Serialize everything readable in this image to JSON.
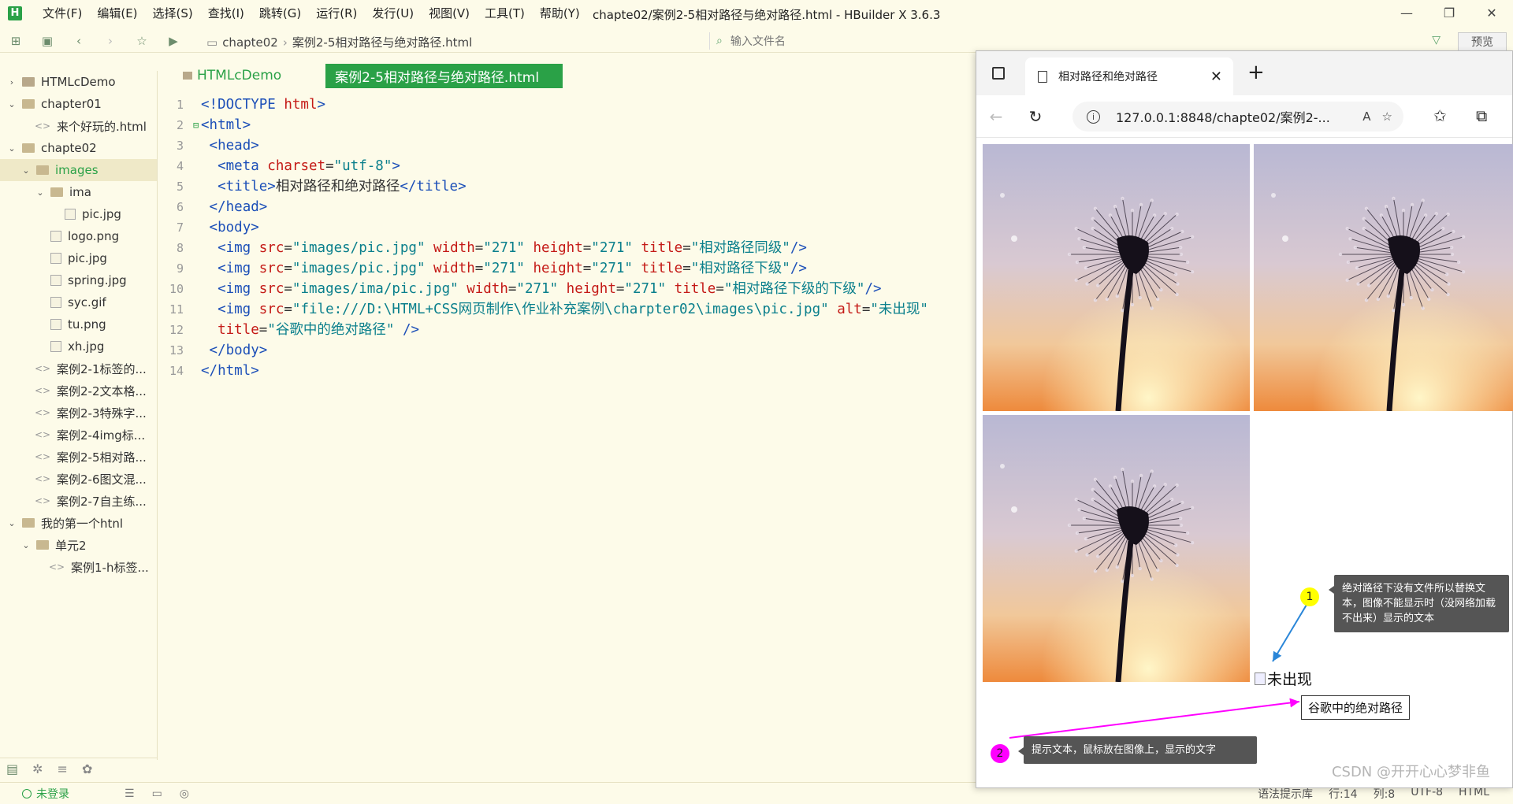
{
  "app": {
    "logo": "H",
    "window_title": "chapte02/案例2-5相对路径与绝对路径.html - HBuilder X 3.6.3",
    "menu": [
      "文件(F)",
      "编辑(E)",
      "选择(S)",
      "查找(I)",
      "跳转(G)",
      "运行(R)",
      "发行(U)",
      "视图(V)",
      "工具(T)",
      "帮助(Y)"
    ]
  },
  "toolbar": {
    "breadcrumb": [
      "chapte02",
      "案例2-5相对路径与绝对路径.html"
    ],
    "file_search_placeholder": "输入文件名",
    "preview_label": "预览"
  },
  "sidebar": {
    "items": [
      {
        "label": "HTMLcDemo",
        "level": 0,
        "kind": "folder",
        "caret": "›"
      },
      {
        "label": "chapter01",
        "level": 0,
        "kind": "folder",
        "caret": "⌄"
      },
      {
        "label": "来个好玩的.html",
        "level": 1,
        "kind": "file",
        "caret": ""
      },
      {
        "label": "chapte02",
        "level": 0,
        "kind": "folder",
        "caret": "⌄"
      },
      {
        "label": "images",
        "level": 1,
        "kind": "folder",
        "caret": "⌄",
        "selected": true
      },
      {
        "label": "ima",
        "level": 2,
        "kind": "folder",
        "caret": "⌄"
      },
      {
        "label": "pic.jpg",
        "level": 3,
        "kind": "image",
        "caret": ""
      },
      {
        "label": "logo.png",
        "level": 2,
        "kind": "image",
        "caret": ""
      },
      {
        "label": "pic.jpg",
        "level": 2,
        "kind": "image",
        "caret": ""
      },
      {
        "label": "spring.jpg",
        "level": 2,
        "kind": "image",
        "caret": ""
      },
      {
        "label": "syc.gif",
        "level": 2,
        "kind": "image",
        "caret": ""
      },
      {
        "label": "tu.png",
        "level": 2,
        "kind": "image",
        "caret": ""
      },
      {
        "label": "xh.jpg",
        "level": 2,
        "kind": "image",
        "caret": ""
      },
      {
        "label": "案例2-1标签的...",
        "level": 1,
        "kind": "file",
        "caret": ""
      },
      {
        "label": "案例2-2文本格...",
        "level": 1,
        "kind": "file",
        "caret": ""
      },
      {
        "label": "案例2-3特殊字...",
        "level": 1,
        "kind": "file",
        "caret": ""
      },
      {
        "label": "案例2-4img标...",
        "level": 1,
        "kind": "file",
        "caret": ""
      },
      {
        "label": "案例2-5相对路...",
        "level": 1,
        "kind": "file",
        "caret": ""
      },
      {
        "label": "案例2-6图文混...",
        "level": 1,
        "kind": "file",
        "caret": ""
      },
      {
        "label": "案例2-7自主练...",
        "level": 1,
        "kind": "file",
        "caret": ""
      },
      {
        "label": "我的第一个htnl",
        "level": 0,
        "kind": "folder",
        "caret": "⌄"
      },
      {
        "label": "单元2",
        "level": 1,
        "kind": "folder",
        "caret": "⌄"
      },
      {
        "label": "案例1-h标签...",
        "level": 2,
        "kind": "file",
        "caret": ""
      }
    ]
  },
  "editor": {
    "folder_tab": "HTMLcDemo",
    "active_tab": "案例2-5相对路径与绝对路径.html",
    "lines": [
      [
        [
          "doc",
          "<!DOCTYPE "
        ],
        [
          "attr",
          "html"
        ],
        [
          "doc",
          ">"
        ]
      ],
      [
        [
          "tag",
          "<html>"
        ]
      ],
      [
        [
          "txt",
          " "
        ],
        [
          "tag",
          "<head>"
        ]
      ],
      [
        [
          "txt",
          "  "
        ],
        [
          "tag",
          "<meta "
        ],
        [
          "attr",
          "charset"
        ],
        [
          "txt",
          "="
        ],
        [
          "str",
          "\"utf-8\""
        ],
        [
          "tag",
          ">"
        ]
      ],
      [
        [
          "txt",
          "  "
        ],
        [
          "tag",
          "<title>"
        ],
        [
          "txt",
          "相对路径和绝对路径"
        ],
        [
          "tag",
          "</title>"
        ]
      ],
      [
        [
          "txt",
          " "
        ],
        [
          "tag",
          "</head>"
        ]
      ],
      [
        [
          "txt",
          " "
        ],
        [
          "tag",
          "<body>"
        ]
      ],
      [
        [
          "txt",
          "  "
        ],
        [
          "tag",
          "<img "
        ],
        [
          "attr",
          "src"
        ],
        [
          "txt",
          "="
        ],
        [
          "str",
          "\"images/pic.jpg\""
        ],
        [
          "txt",
          " "
        ],
        [
          "attr",
          "width"
        ],
        [
          "txt",
          "="
        ],
        [
          "str",
          "\"271\""
        ],
        [
          "txt",
          " "
        ],
        [
          "attr",
          "height"
        ],
        [
          "txt",
          "="
        ],
        [
          "str",
          "\"271\""
        ],
        [
          "txt",
          " "
        ],
        [
          "attr",
          "title"
        ],
        [
          "txt",
          "="
        ],
        [
          "str",
          "\"相对路径同级\""
        ],
        [
          "tag",
          "/>"
        ]
      ],
      [
        [
          "txt",
          "  "
        ],
        [
          "tag",
          "<img "
        ],
        [
          "attr",
          "src"
        ],
        [
          "txt",
          "="
        ],
        [
          "str",
          "\"images/pic.jpg\""
        ],
        [
          "txt",
          " "
        ],
        [
          "attr",
          "width"
        ],
        [
          "txt",
          "="
        ],
        [
          "str",
          "\"271\""
        ],
        [
          "txt",
          " "
        ],
        [
          "attr",
          "height"
        ],
        [
          "txt",
          "="
        ],
        [
          "str",
          "\"271\""
        ],
        [
          "txt",
          " "
        ],
        [
          "attr",
          "title"
        ],
        [
          "txt",
          "="
        ],
        [
          "str",
          "\"相对路径下级\""
        ],
        [
          "tag",
          "/>"
        ]
      ],
      [
        [
          "txt",
          "  "
        ],
        [
          "tag",
          "<img "
        ],
        [
          "attr",
          "src"
        ],
        [
          "txt",
          "="
        ],
        [
          "str",
          "\"images/ima/pic.jpg\""
        ],
        [
          "txt",
          " "
        ],
        [
          "attr",
          "width"
        ],
        [
          "txt",
          "="
        ],
        [
          "str",
          "\"271\""
        ],
        [
          "txt",
          " "
        ],
        [
          "attr",
          "height"
        ],
        [
          "txt",
          "="
        ],
        [
          "str",
          "\"271\""
        ],
        [
          "txt",
          " "
        ],
        [
          "attr",
          "title"
        ],
        [
          "txt",
          "="
        ],
        [
          "str",
          "\"相对路径下级的下级\""
        ],
        [
          "tag",
          "/>"
        ]
      ],
      [
        [
          "txt",
          "  "
        ],
        [
          "tag",
          "<img "
        ],
        [
          "attr",
          "src"
        ],
        [
          "txt",
          "="
        ],
        [
          "str",
          "\"file:///D:\\HTML+CSS网页制作\\作业补充案例\\charpter02\\images\\pic.jpg\""
        ],
        [
          "txt",
          " "
        ],
        [
          "attr",
          "alt"
        ],
        [
          "txt",
          "="
        ],
        [
          "str",
          "\"未出现\""
        ]
      ],
      [
        [
          "txt",
          "  "
        ],
        [
          "attr",
          "title"
        ],
        [
          "txt",
          "="
        ],
        [
          "str",
          "\"谷歌中的绝对路径\""
        ],
        [
          "txt",
          " "
        ],
        [
          "tag",
          "/>"
        ]
      ],
      [
        [
          "txt",
          " "
        ],
        [
          "tag",
          "</body>"
        ]
      ],
      [
        [
          "tag",
          "</html>"
        ]
      ]
    ]
  },
  "status": {
    "login": "未登录",
    "syntax": "语法提示库",
    "row": "行:14",
    "col": "列:8",
    "encoding": "UTF-8",
    "lang": "HTML"
  },
  "browser": {
    "tab_title": "相对路径和绝对路径",
    "url": "127.0.0.1:8848/chapte02/案例2-...",
    "broken_alt": "未出现",
    "tooltip": "谷歌中的绝对路径",
    "note1_num": "1",
    "note1_text": "绝对路径下没有文件所以替换文本，图像不能显示时（没网络加载不出来）显示的文本",
    "note2_num": "2",
    "note2_text": "提示文本，鼠标放在图像上，显示的文字",
    "watermark": "CSDN @开开心心梦非鱼"
  },
  "colors": {
    "accent": "#2aa147",
    "ide_bg": "#fdfbe9",
    "marker1": "#ffff00",
    "marker2": "#ff00ff",
    "arrow1": "#2a86d8",
    "arrow2": "#ff00ff"
  }
}
